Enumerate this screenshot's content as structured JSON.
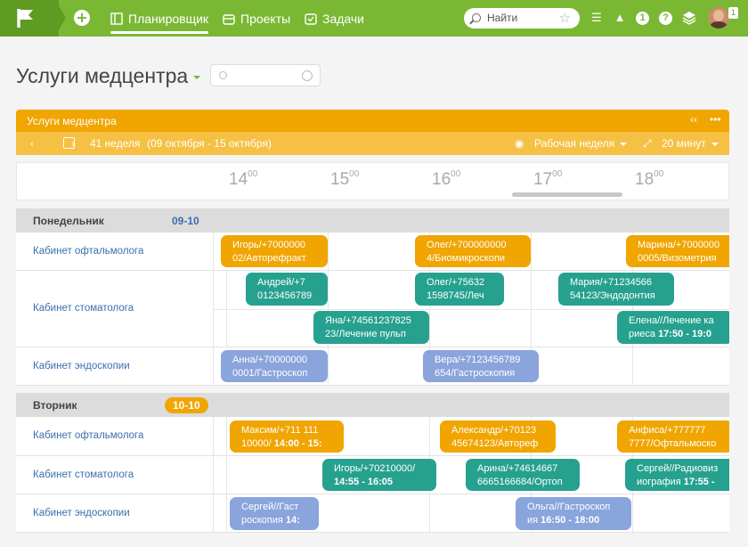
{
  "nav": {
    "items": [
      "Планировщик",
      "Проекты",
      "Задачи"
    ],
    "search_placeholder": "Найти",
    "notification_count": "1",
    "avatar_badge": "1"
  },
  "page": {
    "title": "Услуги медцентра"
  },
  "widget": {
    "title": "Услуги медцентра",
    "week": "41 неделя",
    "range": "(09 октября - 15 октября)",
    "view": "Рабочая неделя",
    "step": "20 минут"
  },
  "hours": [
    "14",
    "15",
    "16",
    "17",
    "18"
  ],
  "days": [
    {
      "name": "Понедельник",
      "count": "09-10",
      "rooms": [
        {
          "name": "Кабинет офтальмолога",
          "events": [
            {
              "l1": "Игорь/+7000000",
              "l2": "02/Авторефракт",
              "color": "orange"
            },
            {
              "l1": "Олег/+700000000",
              "l2": "4/Биомикроскопи",
              "color": "orange"
            },
            {
              "l1": "Марина/+7000000",
              "l2": "0005/Визометрия",
              "color": "orange"
            }
          ]
        },
        {
          "name": "Кабинет стоматолога",
          "events": [
            {
              "l1": "Андрей/+7",
              "l2": "0123456789",
              "color": "teal"
            },
            {
              "l1": "Олег/+75632",
              "l2": "1598745/Леч",
              "color": "teal"
            },
            {
              "l1": "Мария/+71234566",
              "l2": "54123/Эндодонтия",
              "color": "teal"
            },
            {
              "l1": "Яна/+74561237825",
              "l2": "23/Лечение пульп",
              "color": "teal"
            },
            {
              "l1": "Елена//Лечение ка",
              "l2": "риеса ",
              "l2b": "17:50 - 19:0",
              "color": "teal"
            }
          ]
        },
        {
          "name": "Кабинет эндоскопии",
          "events": [
            {
              "l1": "Анна/+70000000",
              "l2": "0001/Гастроскоп",
              "color": "blue"
            },
            {
              "l1": "Вера/+7123456789",
              "l2": "654/Гастроскопия",
              "color": "blue"
            }
          ]
        }
      ]
    },
    {
      "name": "Вторник",
      "count": "10-10",
      "rooms": [
        {
          "name": "Кабинет офтальмолога",
          "events": [
            {
              "l1": "Максим/+711  111",
              "l2": "10000/ ",
              "l2b": "14:00 - 15:",
              "color": "orange"
            },
            {
              "l1": "Александр/+70123",
              "l2": "45674123/Автореф",
              "color": "orange"
            },
            {
              "l1": "Анфиса/+777777",
              "l2": "7777/Офтальмоско",
              "color": "orange"
            }
          ]
        },
        {
          "name": "Кабинет стоматолога",
          "events": [
            {
              "l1": "Игорь/+70210000/",
              "l2": "",
              "l2b": "14:55 - 16:05",
              "color": "teal"
            },
            {
              "l1": "Арина/+74614667",
              "l2": "6665166684/Ортоп",
              "color": "teal"
            },
            {
              "l1": "Сергей//Радиовиз",
              "l2": "иография ",
              "l2b": "17:55 -",
              "color": "teal"
            }
          ]
        },
        {
          "name": "Кабинет эндоскопии",
          "events": [
            {
              "l1": "Сергей//Гаст",
              "l2": "роскопия ",
              "l2b": "14:",
              "color": "blue"
            },
            {
              "l1": "Ольга//Гастроскоп",
              "l2": "ия ",
              "l2b": "16:50 - 18:00",
              "color": "blue"
            }
          ]
        }
      ]
    }
  ]
}
